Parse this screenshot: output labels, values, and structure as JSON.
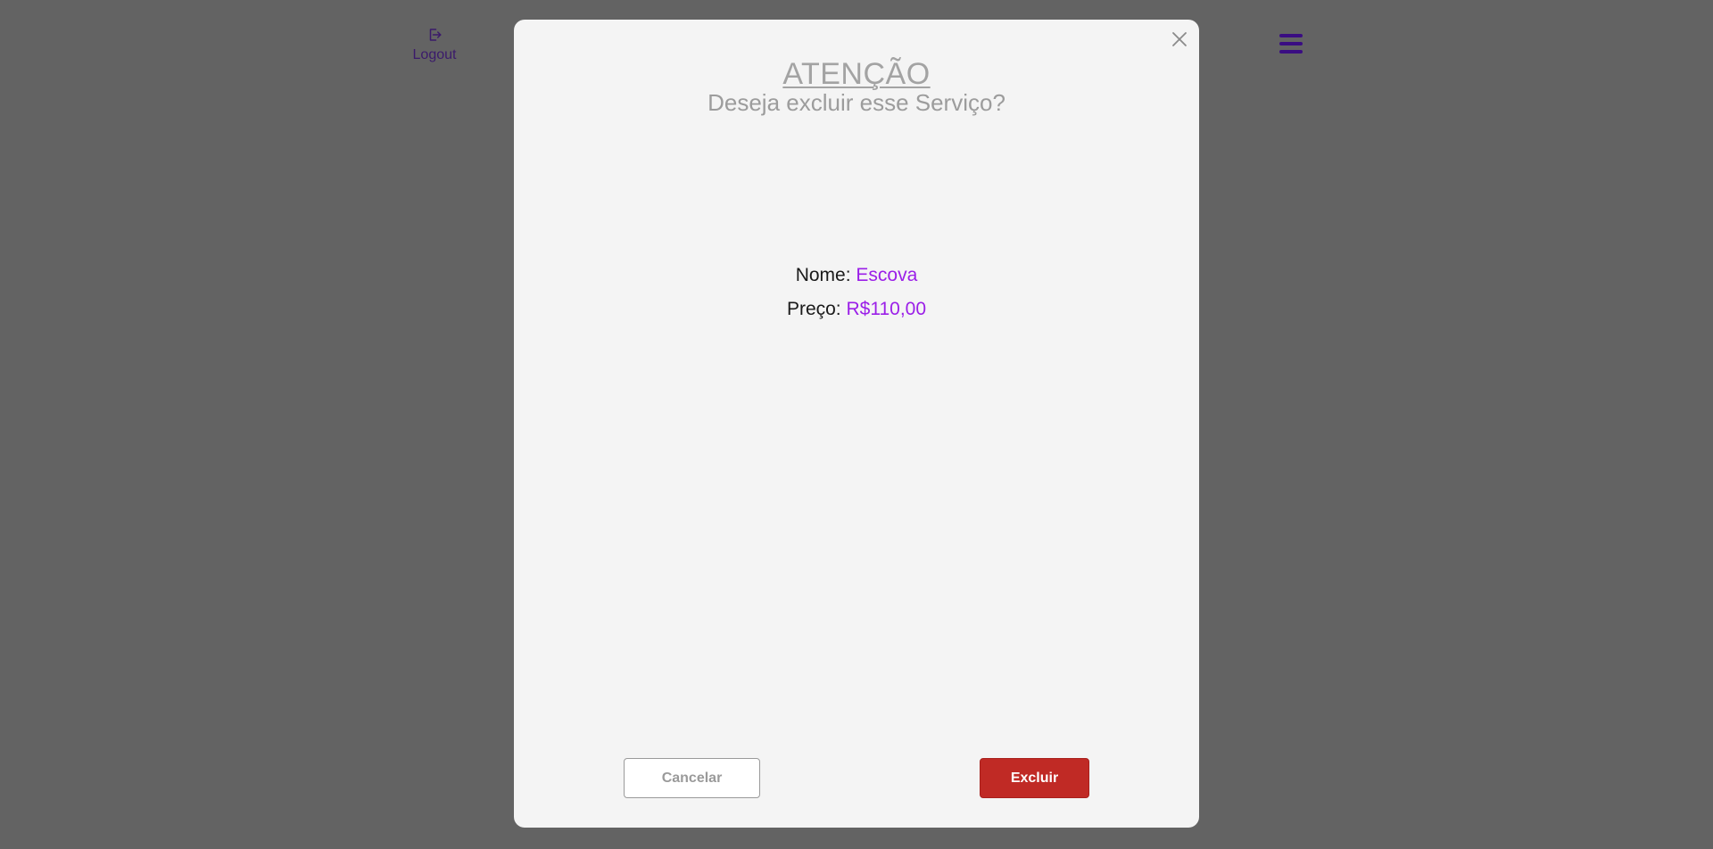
{
  "header": {
    "logout_label": "Logout",
    "logout_icon": "logout-icon",
    "menu_icon": "hamburger-menu-icon"
  },
  "modal": {
    "title": "ATENÇÃO",
    "subtitle": "Deseja excluir esse Serviço?",
    "close_icon": "close-icon",
    "name_label": "Nome:",
    "name_value": "Escova",
    "price_label": "Preço:",
    "price_value": "R$110,00",
    "cancel_label": "Cancelar",
    "delete_label": "Excluir"
  },
  "colors": {
    "overlay": "#636363",
    "accent": "#9b1fe8",
    "danger": "#c02a25",
    "nav": "#3a0d82"
  }
}
